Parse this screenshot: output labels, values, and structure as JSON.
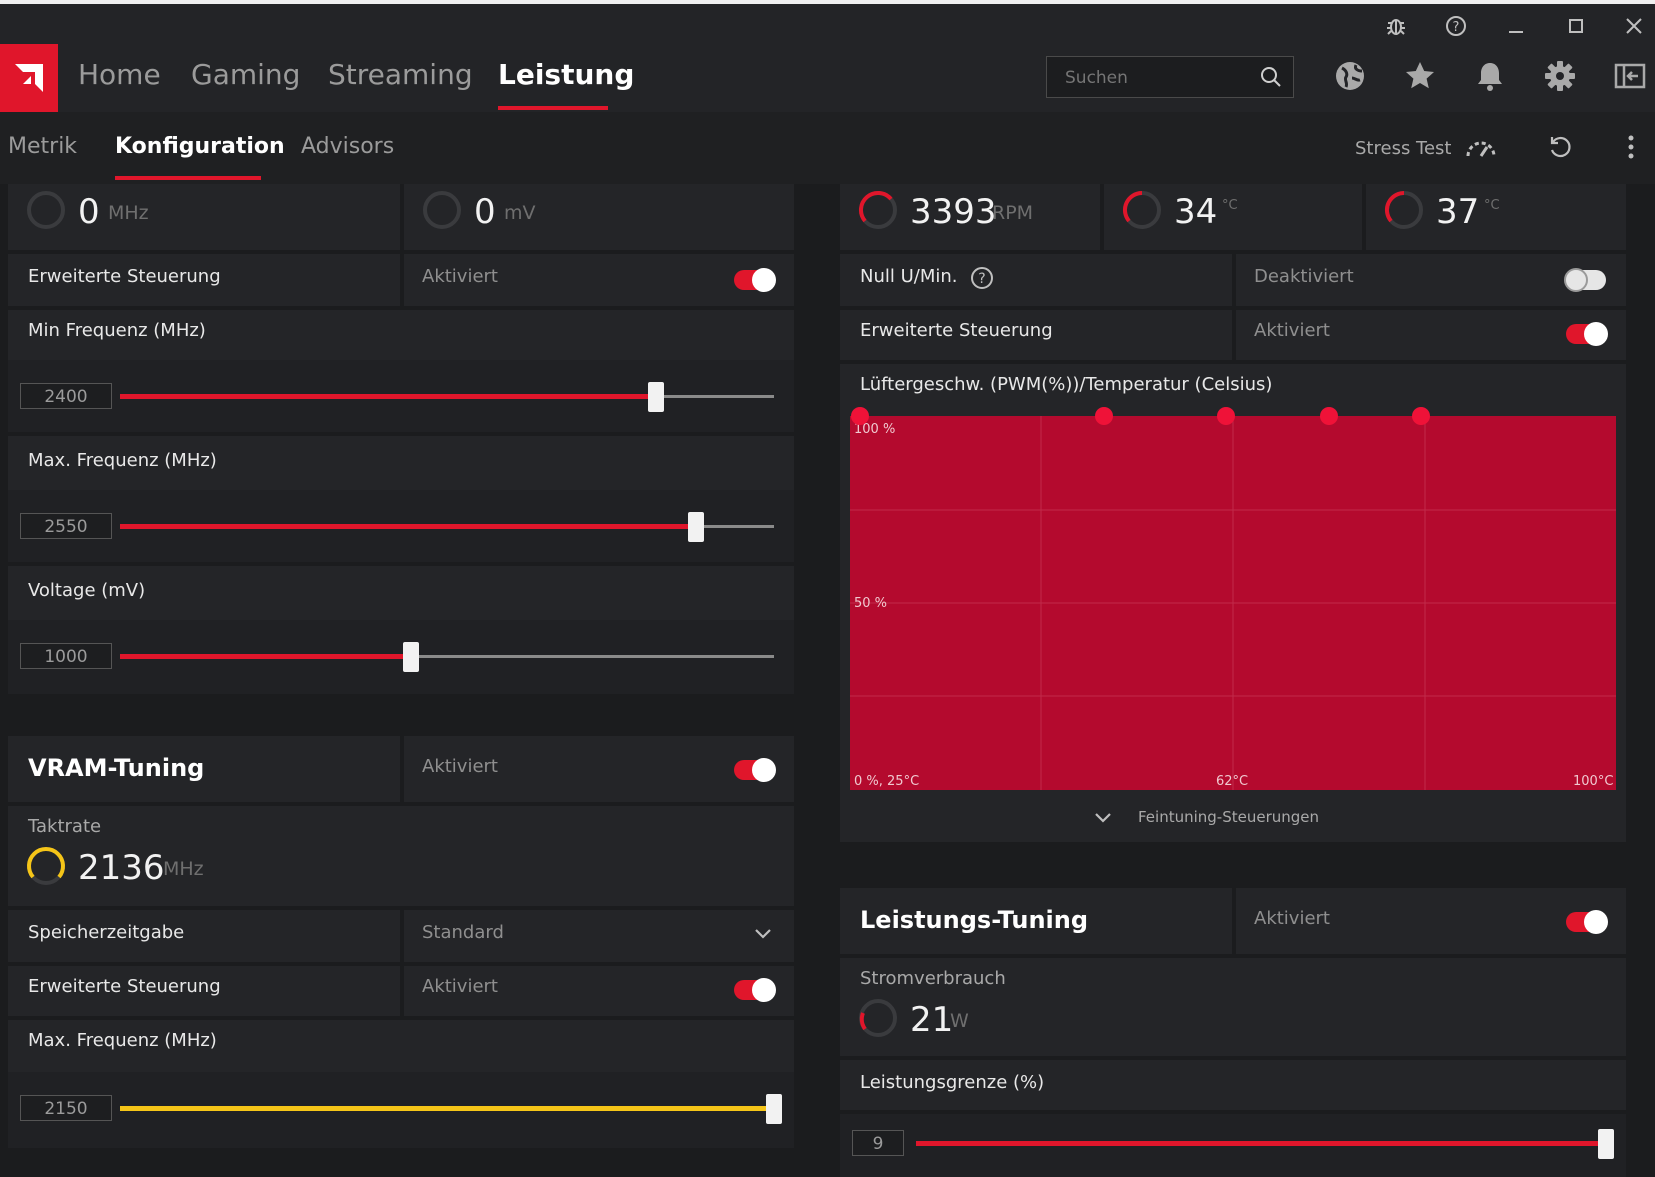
{
  "titlebar": {
    "icons": [
      "bug-icon",
      "help-icon",
      "minimize-icon",
      "maximize-icon",
      "close-icon"
    ]
  },
  "nav": {
    "tabs": [
      {
        "label": "Home"
      },
      {
        "label": "Gaming"
      },
      {
        "label": "Streaming"
      },
      {
        "label": "Leistung"
      }
    ],
    "active_tab": "Leistung",
    "search_placeholder": "Suchen"
  },
  "subnav": {
    "tabs": [
      {
        "label": "Metrik"
      },
      {
        "label": "Konfiguration"
      },
      {
        "label": "Advisors"
      }
    ],
    "active_tab": "Konfiguration",
    "stress_test": "Stress Test"
  },
  "gpu": {
    "clock": {
      "value": "0",
      "unit": "MHz"
    },
    "voltage": {
      "value": "0",
      "unit": "mV"
    },
    "advanced": {
      "label": "Erweiterte Steuerung",
      "state": "Aktiviert",
      "on": true
    },
    "min_freq": {
      "label": "Min Frequenz (MHz)",
      "value": "2400",
      "fraction": 0.82
    },
    "max_freq": {
      "label": "Max. Frequenz (MHz)",
      "value": "2550",
      "fraction": 0.88
    },
    "voltage_slider": {
      "label": "Voltage (mV)",
      "value": "1000",
      "fraction": 0.445
    }
  },
  "vram": {
    "title": "VRAM-Tuning",
    "state": "Aktiviert",
    "on": true,
    "clock_label": "Taktrate",
    "clock": {
      "value": "2136",
      "unit": "MHz"
    },
    "timing": {
      "label": "Speicherzeitgabe",
      "value": "Standard"
    },
    "advanced": {
      "label": "Erweiterte Steuerung",
      "state": "Aktiviert",
      "on": true
    },
    "max_freq": {
      "label": "Max. Frequenz (MHz)",
      "value": "2150",
      "fraction": 1.0
    }
  },
  "fan": {
    "rpm": {
      "value": "3393",
      "unit": "RPM"
    },
    "temp1": {
      "value": "34",
      "unit": "°C"
    },
    "temp2": {
      "value": "37",
      "unit": "°C"
    },
    "zero_rpm": {
      "label": "Null U/Min.",
      "state": "Deaktiviert",
      "on": false
    },
    "advanced": {
      "label": "Erweiterte Steuerung",
      "state": "Aktiviert",
      "on": true
    },
    "curve_title": "Lüftergeschw. (PWM(%))/Temperatur (Celsius)",
    "chart_labels": {
      "top": "100 %",
      "mid": "50 %",
      "bottom_left": "0 %, 25°C",
      "bottom_mid": "62°C",
      "bottom_right": "100°C"
    },
    "fine_tune": "Feintuning-Steuerungen"
  },
  "power": {
    "title": "Leistungs-Tuning",
    "state": "Aktiviert",
    "on": true,
    "consumption_label": "Stromverbrauch",
    "consumption": {
      "value": "21",
      "unit": "W"
    },
    "limit": {
      "label": "Leistungsgrenze (%)",
      "value": "9",
      "fraction": 1.0
    }
  },
  "colors": {
    "accent": "#e0162b",
    "vram_accent": "#f5c518",
    "chart_bg": "#b40a2e"
  }
}
